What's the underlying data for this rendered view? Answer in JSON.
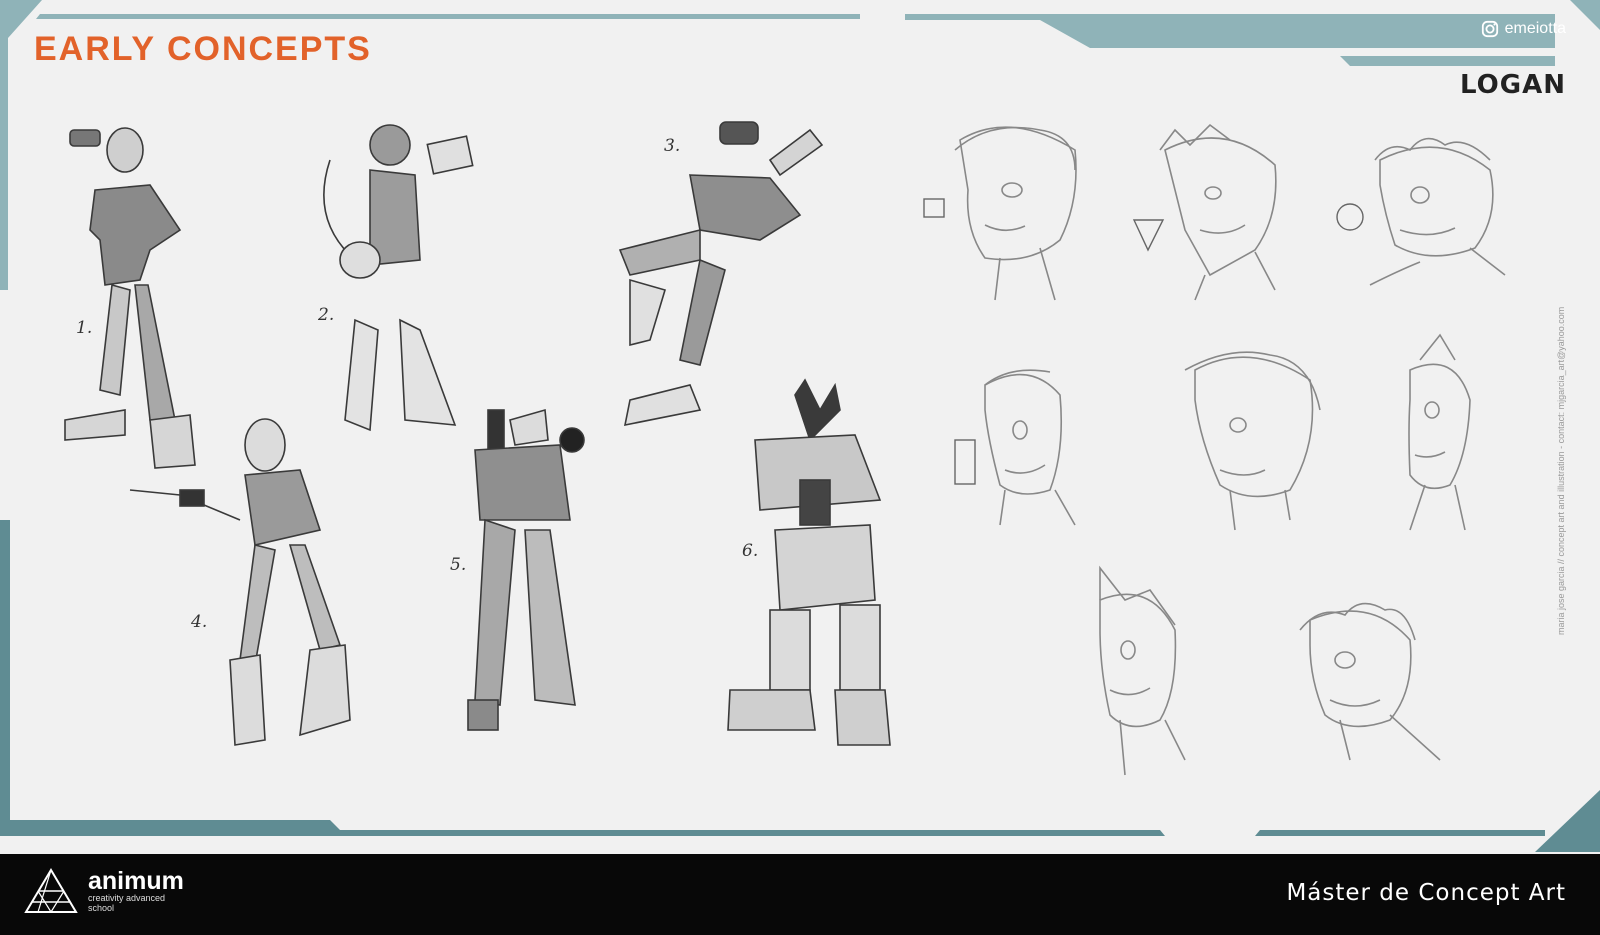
{
  "header": {
    "title": "EARLY CONCEPTS",
    "social_handle": "emeiotta",
    "character_name": "LOGAN",
    "credit": "maria jose garcia // concept art and illustration  -  contact: mjgarcia_art@yahoo.com"
  },
  "concepts": [
    {
      "number": "1."
    },
    {
      "number": "2."
    },
    {
      "number": "3."
    },
    {
      "number": "4."
    },
    {
      "number": "5."
    },
    {
      "number": "6."
    }
  ],
  "head_studies": {
    "shape_cues": [
      "square",
      "triangle",
      "circle",
      "rectangle"
    ],
    "count": 8
  },
  "footer": {
    "brand": "animum",
    "brand_tagline": "creativity advanced school",
    "course": "Máster de Concept Art"
  },
  "colors": {
    "accent": "#e2622a",
    "frame_teal": "#8fb3b8",
    "frame_dark": "#5f8c93",
    "background": "#f1f1f1",
    "footer": "#080808"
  },
  "icons": [
    "instagram-icon",
    "animum-logo-icon"
  ]
}
